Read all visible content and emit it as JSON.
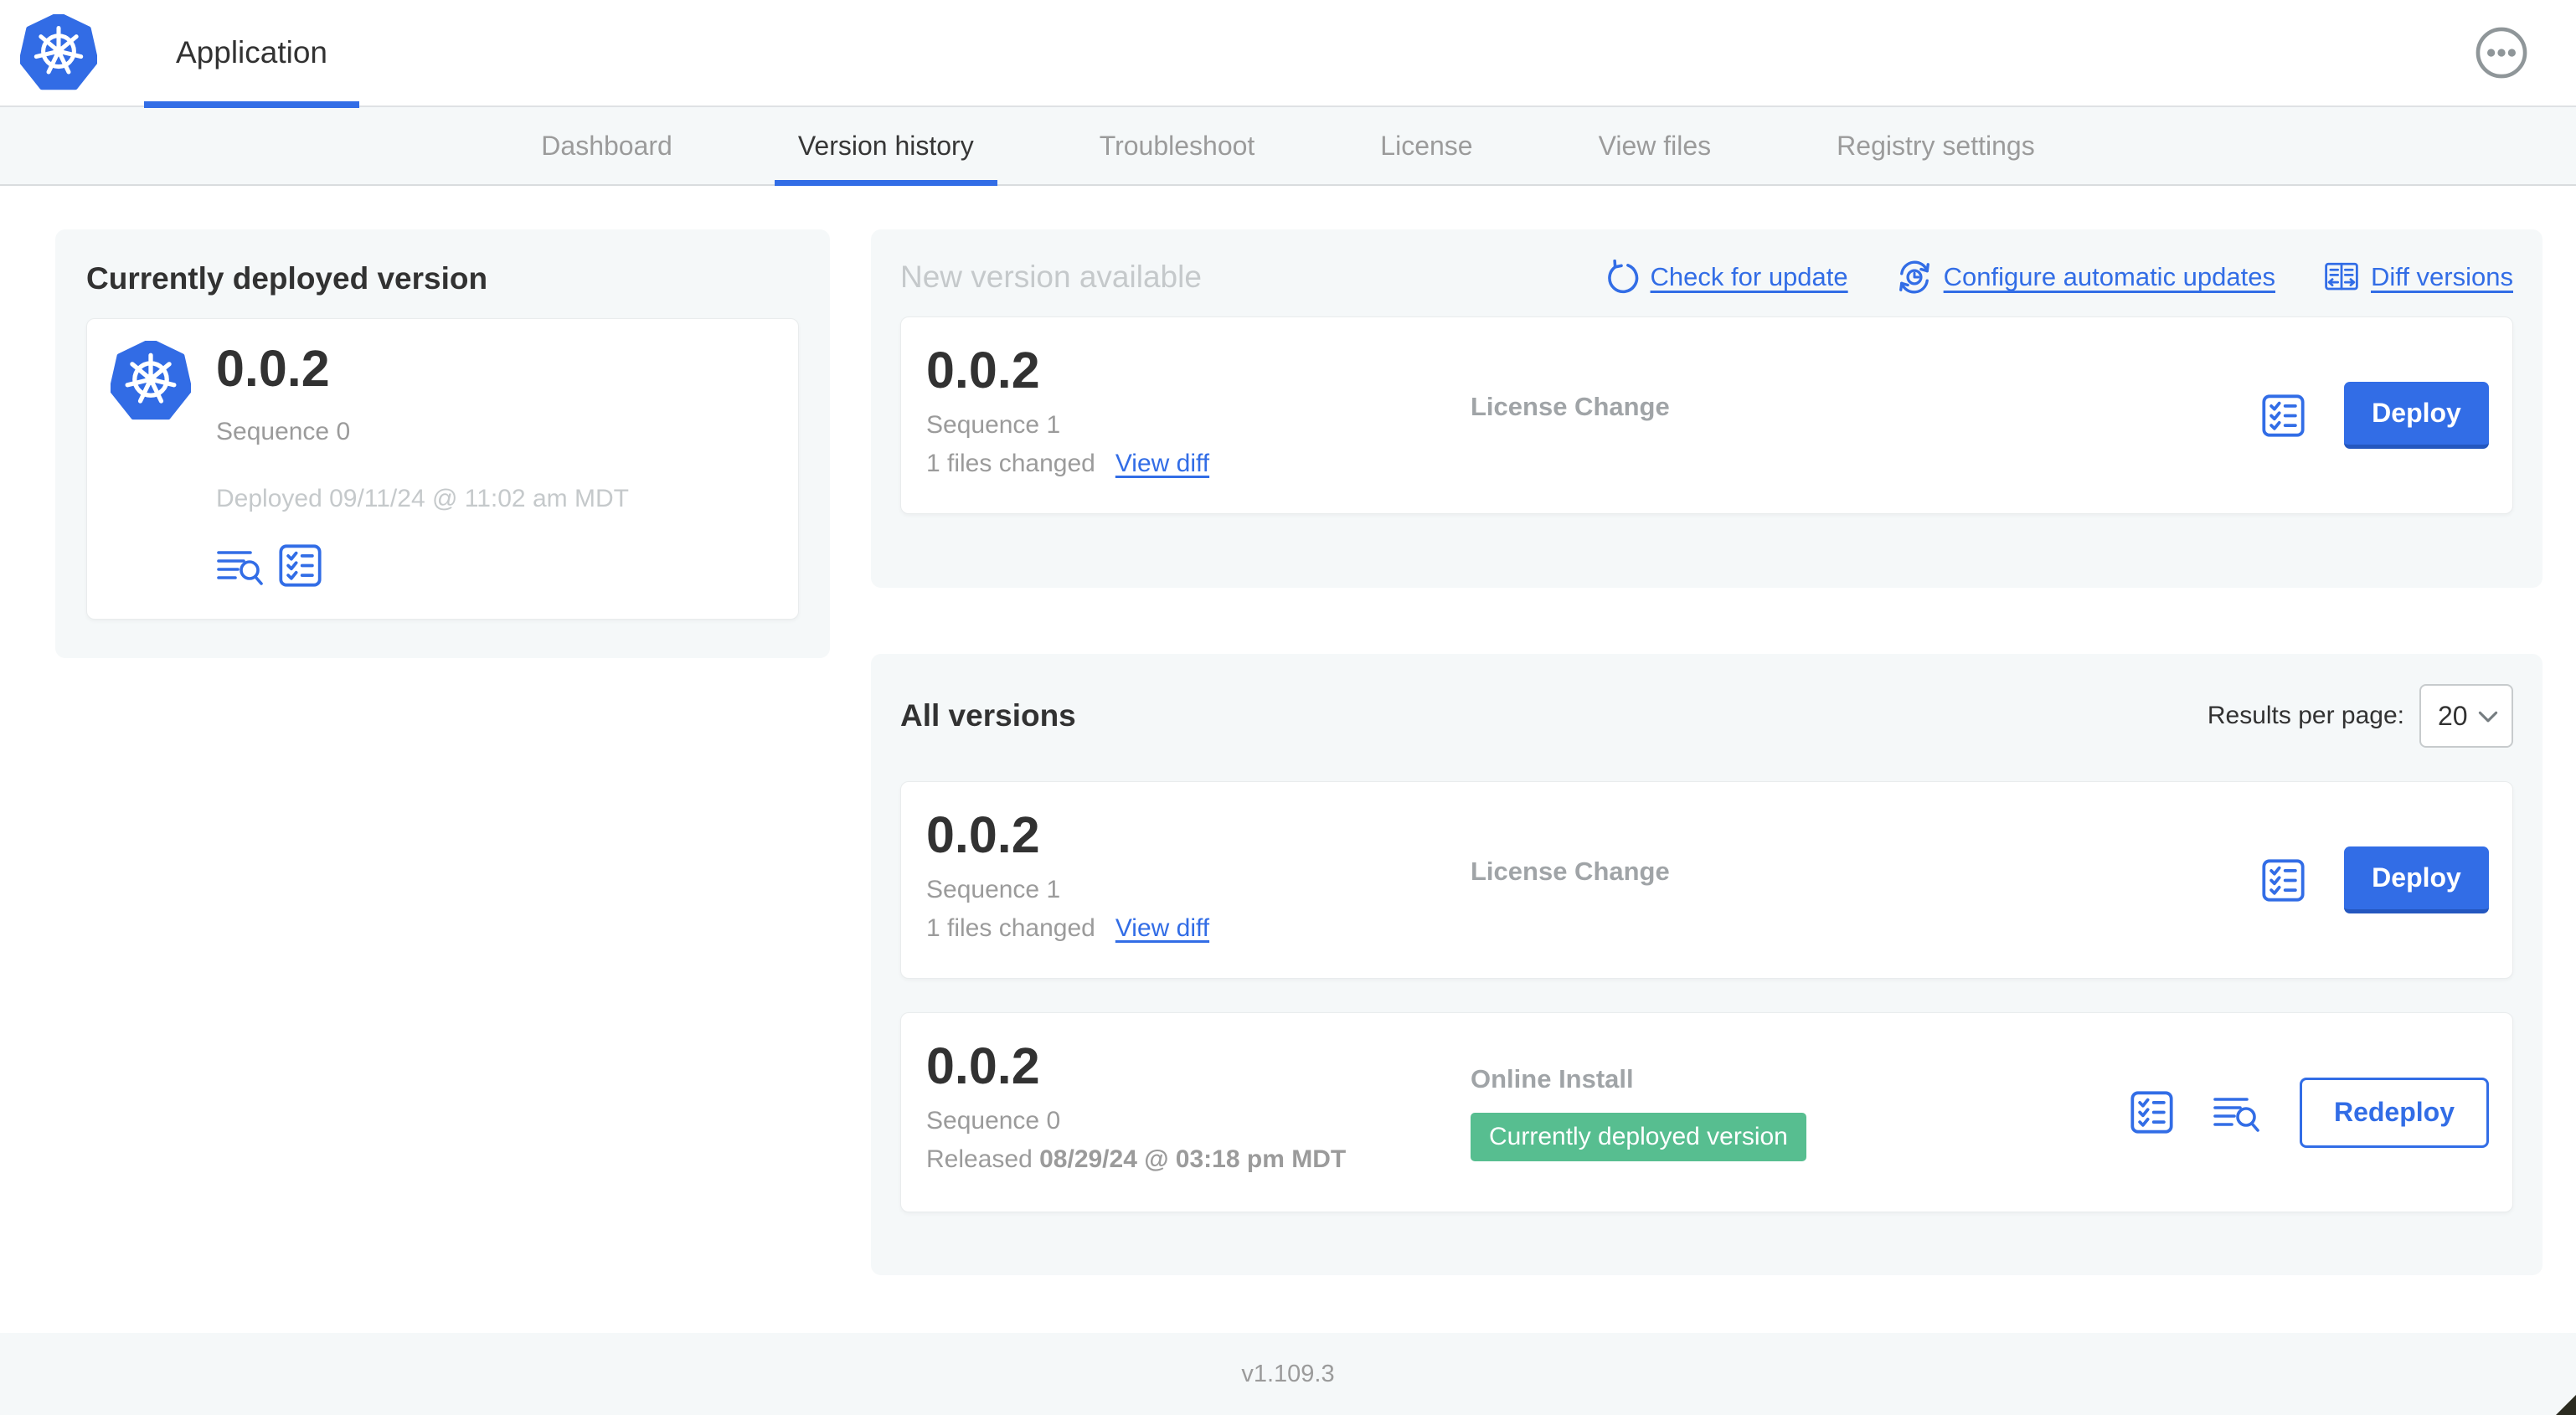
{
  "header": {
    "app_tab_label": "Application",
    "more_menu_icon": "ellipsis-in-circle-icon",
    "logo_icon": "kubernetes-logo-icon"
  },
  "nav": {
    "tabs": [
      {
        "label": "Dashboard",
        "active": false
      },
      {
        "label": "Version history",
        "active": true
      },
      {
        "label": "Troubleshoot",
        "active": false
      },
      {
        "label": "License",
        "active": false
      },
      {
        "label": "View files",
        "active": false
      },
      {
        "label": "Registry settings",
        "active": false
      }
    ]
  },
  "panels": {
    "current": {
      "title": "Currently deployed version",
      "version": "0.0.2",
      "sequence": "Sequence 0",
      "deployed": "Deployed 09/11/24 @ 11:02 am MDT",
      "icons": [
        "deploy-logs-icon",
        "preflight-checklist-icon"
      ]
    },
    "new_version": {
      "title": "New version available",
      "actions": {
        "check_update": "Check for update",
        "configure": "Configure automatic updates",
        "diff": "Diff versions"
      },
      "card": {
        "version": "0.0.2",
        "sequence": "Sequence 1",
        "files_changed": "1 files changed",
        "view_diff": "View diff",
        "source": "License Change",
        "deploy": "Deploy"
      }
    },
    "all_versions": {
      "title": "All versions",
      "results_per_page_label": "Results per page:",
      "results_per_page_value": "20",
      "rows": [
        {
          "version": "0.0.2",
          "sequence": "Sequence 1",
          "files_changed": "1 files changed",
          "view_diff": "View diff",
          "source": "License Change",
          "action": "Deploy"
        },
        {
          "version": "0.0.2",
          "sequence": "Sequence 0",
          "released_prefix": "Released",
          "released_date": "08/29/24 @ 03:18 pm MDT",
          "source": "Online Install",
          "status_badge": "Currently deployed version",
          "action": "Redeploy"
        }
      ]
    }
  },
  "footer": {
    "version_label": "v1.109.3"
  },
  "colors": {
    "accent_blue": "#326DE6",
    "kubernetes_blue": "#326CE5",
    "success_green": "#57BE90",
    "panel_gray": "#f5f8f9",
    "text_dark": "#323232",
    "text_gray": "#9b9b9b",
    "text_light_gray": "#c5c9cb"
  }
}
